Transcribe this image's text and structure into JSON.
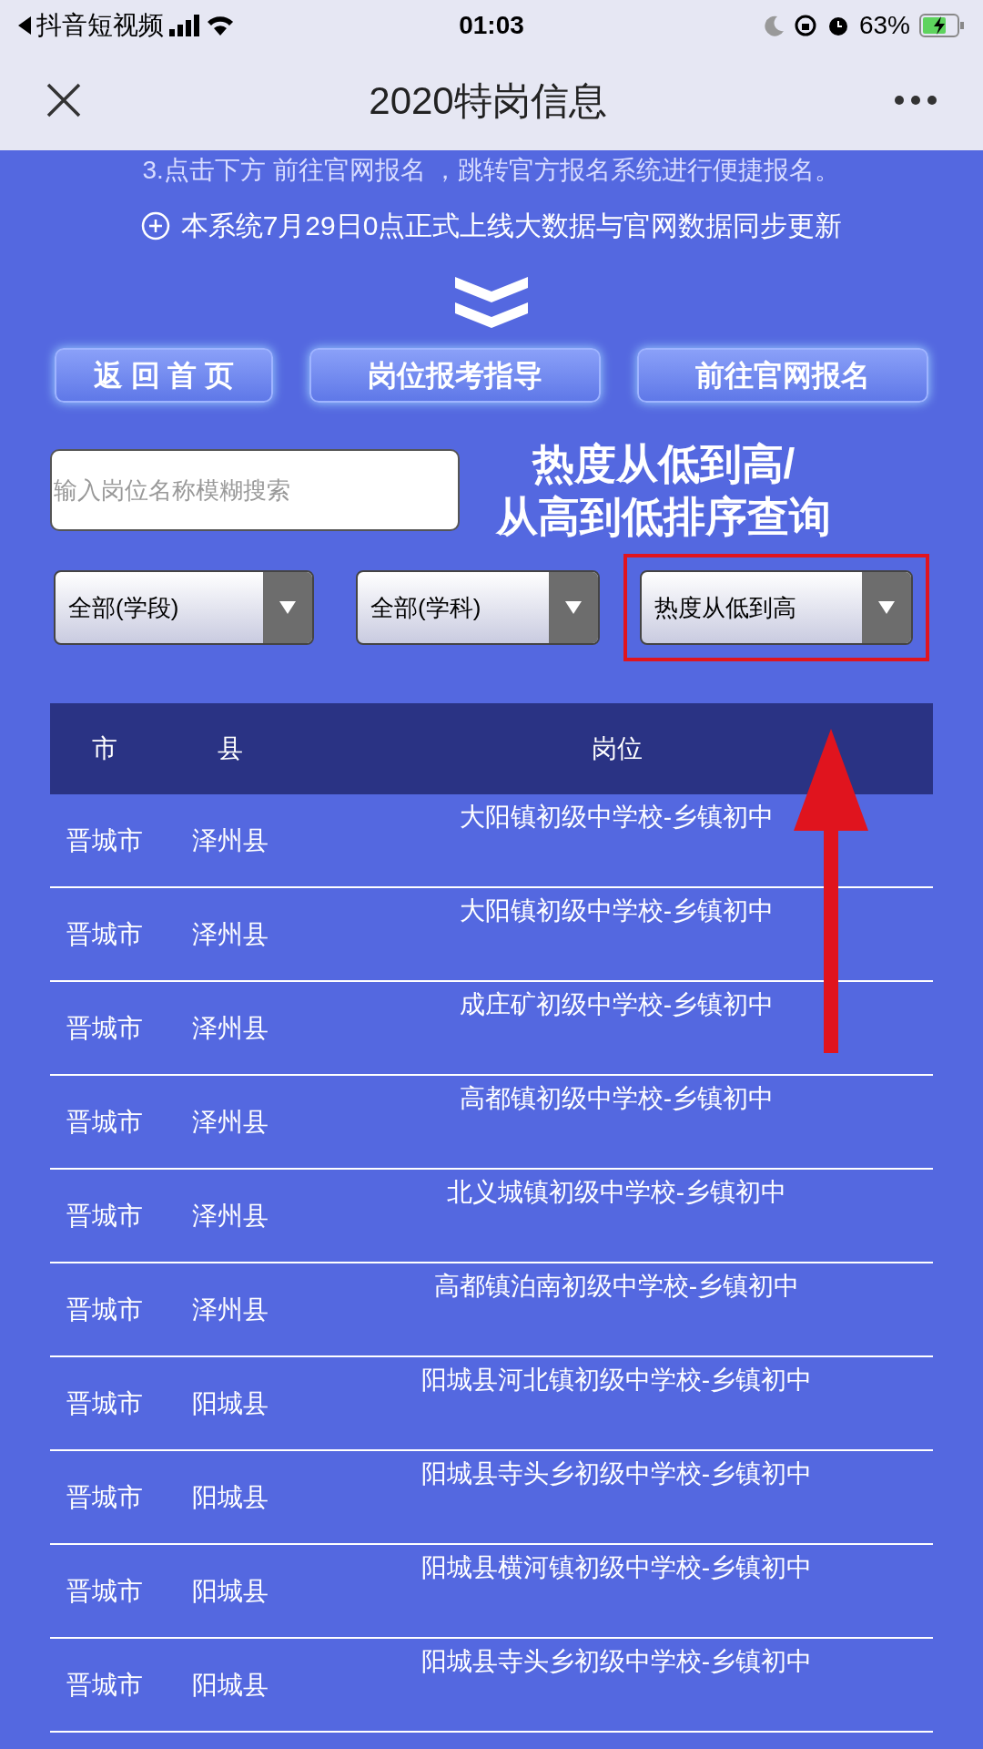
{
  "status_bar": {
    "back_app": "抖音短视频",
    "time": "01:03",
    "battery": "63%"
  },
  "header": {
    "title": "2020特岗信息"
  },
  "notices": [
    "3.点击下方 前往官网报名 ，跳转官方报名系统进行便捷报名。",
    "本系统7月29日0点正式上线大数据与官网数据同步更新"
  ],
  "nav_buttons": [
    "返 回 首 页",
    "岗位报考指导",
    "前往官网报名"
  ],
  "search": {
    "placeholder": "输入岗位名称模糊搜索"
  },
  "caption": [
    "热度从低到高/",
    "从高到低排序查询"
  ],
  "filters": [
    {
      "value": "全部(学段)",
      "highlighted": false
    },
    {
      "value": "全部(学科)",
      "highlighted": false
    },
    {
      "value": "热度从低到高",
      "highlighted": true
    }
  ],
  "table": {
    "columns": [
      "市",
      "县",
      "岗位"
    ],
    "rows": [
      [
        "晋城市",
        "泽州县",
        "大阳镇初级中学校-乡镇初中"
      ],
      [
        "晋城市",
        "泽州县",
        "大阳镇初级中学校-乡镇初中"
      ],
      [
        "晋城市",
        "泽州县",
        "成庄矿初级中学校-乡镇初中"
      ],
      [
        "晋城市",
        "泽州县",
        "高都镇初级中学校-乡镇初中"
      ],
      [
        "晋城市",
        "泽州县",
        "北义城镇初级中学校-乡镇初中"
      ],
      [
        "晋城市",
        "泽州县",
        "高都镇泊南初级中学校-乡镇初中"
      ],
      [
        "晋城市",
        "阳城县",
        "阳城县河北镇初级中学校-乡镇初中"
      ],
      [
        "晋城市",
        "阳城县",
        "阳城县寺头乡初级中学校-乡镇初中"
      ],
      [
        "晋城市",
        "阳城县",
        "阳城县横河镇初级中学校-乡镇初中"
      ],
      [
        "晋城市",
        "阳城县",
        "阳城县寺头乡初级中学校-乡镇初中"
      ]
    ]
  }
}
